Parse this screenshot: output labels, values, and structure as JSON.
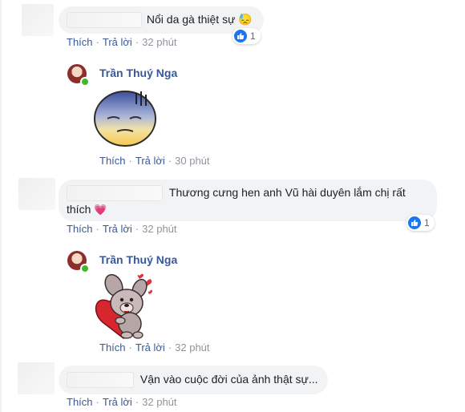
{
  "comments": [
    {
      "text": "Nổi da gà thiệt sự",
      "emoji": "😓",
      "actions": {
        "like": "Thích",
        "reply": "Trả lời",
        "time": "32 phút"
      },
      "reaction_count": "1"
    },
    {
      "text_line1": "Thương cưng hen anh Vũ hài duyên lắm chị rất",
      "text_line2": "thích",
      "emoji": "💗",
      "actions": {
        "like": "Thích",
        "reply": "Trả lời",
        "time": "32 phút"
      },
      "reaction_count": "1"
    },
    {
      "text": "Vận vào cuộc đời của ảnh thật sự...",
      "actions": {
        "like": "Thích",
        "reply": "Trả lời",
        "time": "32 phút"
      }
    }
  ],
  "replies": [
    {
      "author": "Trần Thuý Nga",
      "sticker": "sad-face-sticker",
      "actions": {
        "like": "Thích",
        "reply": "Trả lời",
        "time": "30 phút"
      }
    },
    {
      "author": "Trần Thuý Nga",
      "sticker": "dog-with-heart-sticker",
      "actions": {
        "like": "Thích",
        "reply": "Trả lời",
        "time": "32 phút"
      }
    }
  ],
  "colors": {
    "link": "#385898",
    "bubble": "#f2f3f5",
    "like_blue": "#1877f2",
    "online": "#42b72a"
  }
}
